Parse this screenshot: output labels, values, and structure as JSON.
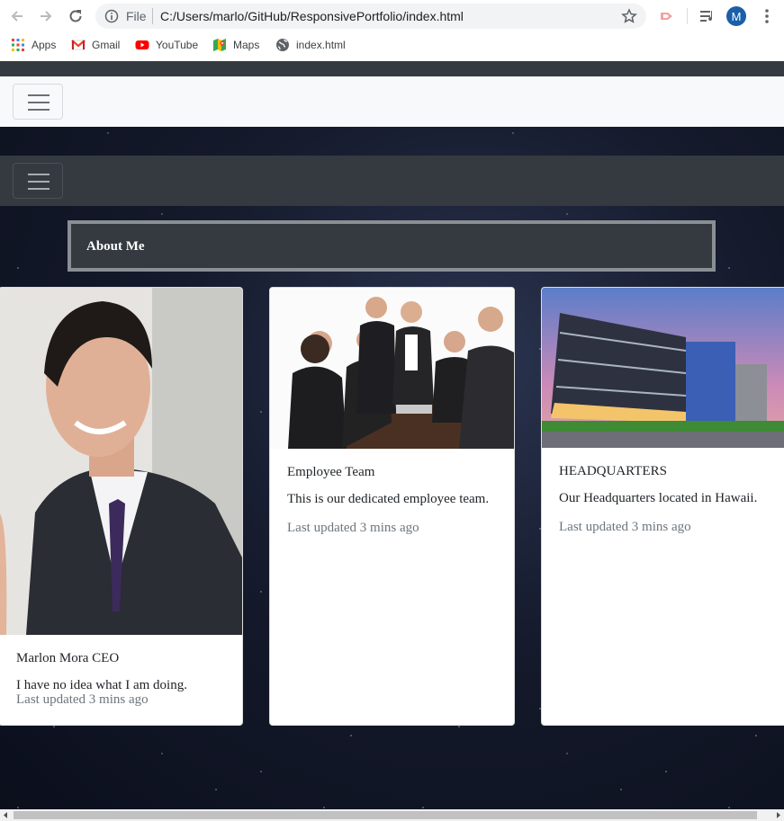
{
  "browser": {
    "omnibox": {
      "scheme_label": "File",
      "url": "C:/Users/marlo/GitHub/ResponsivePortfolio/index.html"
    },
    "profile_initial": "M",
    "bookmarks": [
      {
        "label": "Apps",
        "icon": "apps-grid-icon"
      },
      {
        "label": "Gmail",
        "icon": "gmail-icon"
      },
      {
        "label": "YouTube",
        "icon": "youtube-icon"
      },
      {
        "label": "Maps",
        "icon": "maps-icon"
      },
      {
        "label": "index.html",
        "icon": "globe-icon"
      }
    ]
  },
  "page": {
    "about_heading": "About Me",
    "cards": [
      {
        "title": "Marlon Mora CEO",
        "text": "I have no idea what I am doing.",
        "updated": "Last updated 3 mins ago"
      },
      {
        "title": "Employee Team",
        "text": "This is our dedicated employee team.",
        "updated": "Last updated 3 mins ago"
      },
      {
        "title": "HEADQUARTERS",
        "text": "Our Headquarters located in Hawaii.",
        "updated": "Last updated 3 mins ago"
      }
    ]
  },
  "colors": {
    "navbar_dark": "#343a40",
    "navbar_light": "#f8f9fa",
    "profile": "#1a5fa8"
  }
}
